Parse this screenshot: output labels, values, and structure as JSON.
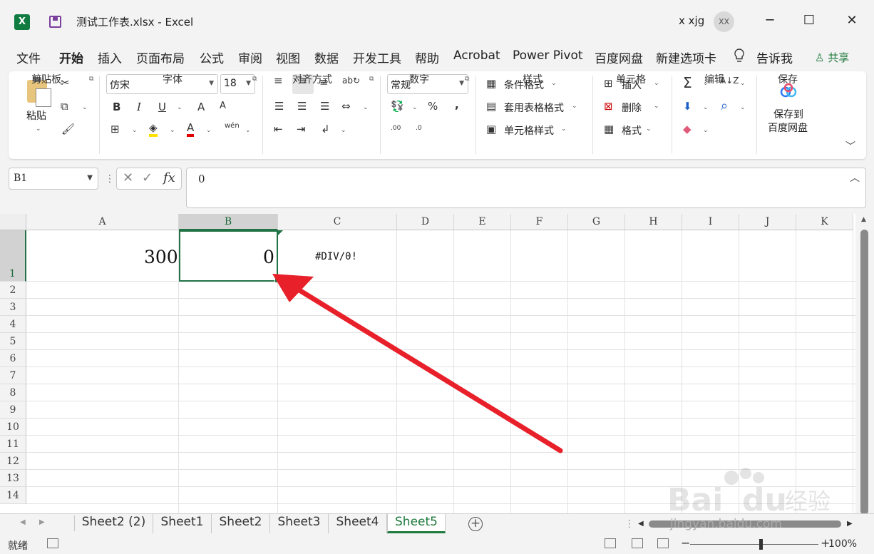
{
  "app": {
    "file_name": "测试工作表.xlsx",
    "separator": " - ",
    "app_name": "Excel",
    "user_name": "x xjg",
    "avatar_initials": "XX",
    "brand_color": "#217346"
  },
  "menu": {
    "tabs": [
      "文件",
      "开始",
      "插入",
      "页面布局",
      "公式",
      "审阅",
      "视图",
      "数据",
      "开发工具",
      "帮助",
      "Acrobat",
      "Power Pivot",
      "百度网盘",
      "新建选项卡"
    ],
    "active_tab": "开始",
    "tell_me": "告诉我",
    "share": "共享"
  },
  "ribbon": {
    "clipboard": {
      "label": "剪贴板",
      "paste": "粘贴"
    },
    "font": {
      "label": "字体",
      "name": "仿宋",
      "size": "18",
      "bold": "B",
      "italic": "I",
      "underline": "U",
      "grow": "A",
      "shrink": "A",
      "font_color": "A",
      "phonetic": "wén"
    },
    "alignment": {
      "label": "对齐方式"
    },
    "number": {
      "label": "数字",
      "format": "常规",
      "percent": "%",
      "comma": ",",
      "inc_decimal": ".00",
      "dec_decimal": ".0"
    },
    "styles": {
      "label": "样式",
      "conditional": "条件格式",
      "table_format": "套用表格格式",
      "cell_styles": "单元格样式"
    },
    "cells": {
      "label": "单元格",
      "insert": "插入",
      "delete": "删除",
      "format": "格式"
    },
    "editing": {
      "label": "编辑"
    },
    "save": {
      "label": "保存",
      "button_line1": "保存到",
      "button_line2": "百度网盘"
    }
  },
  "formula_bar": {
    "name_box": "B1",
    "formula": "0",
    "fx": "fx"
  },
  "grid": {
    "columns": [
      "A",
      "B",
      "C",
      "D",
      "E",
      "F",
      "G",
      "H",
      "I",
      "J",
      "K"
    ],
    "rows": [
      "1",
      "2",
      "3",
      "4",
      "5",
      "6",
      "7",
      "8",
      "9",
      "10",
      "11",
      "12",
      "13",
      "14"
    ],
    "selected_cell": "B1",
    "cells": {
      "A1": "300",
      "B1": "0",
      "C1": "#DIV/0!"
    }
  },
  "annotation": {
    "arrow_color": "#e8202a"
  },
  "sheets": {
    "tabs": [
      "Sheet2 (2)",
      "Sheet1",
      "Sheet2",
      "Sheet3",
      "Sheet4",
      "Sheet5"
    ],
    "active": "Sheet5"
  },
  "status": {
    "mode": "就绪",
    "zoom": "100%"
  },
  "watermark": {
    "text": "jingyan.baidu.com"
  }
}
